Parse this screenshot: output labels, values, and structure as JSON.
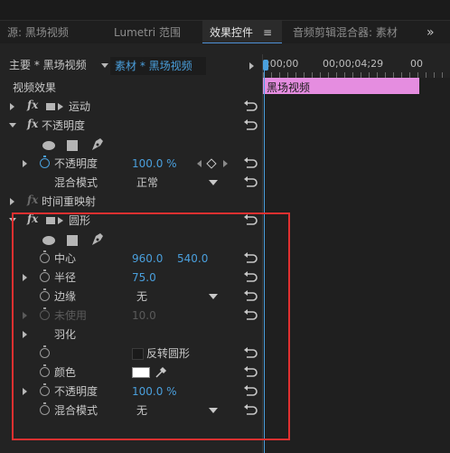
{
  "tabs": [
    {
      "label": "源: 黑场视频"
    },
    {
      "label": "Lumetri 范围"
    },
    {
      "label": "效果控件"
    },
    {
      "label": "音频剪辑混合器: 素材"
    }
  ],
  "tab_menu_icon": "≡",
  "tab_overflow_icon": "»",
  "header": {
    "master": "主要 * 黑场视频",
    "clip": "素材 * 黑场视频"
  },
  "timeline": {
    "start_tc": ";00;00",
    "mid_tc": "00;00;04;29",
    "end_tc": "00",
    "clip_label": "黑场视频"
  },
  "section_label": "视频效果",
  "effects": {
    "motion": "运动",
    "opacity": {
      "name": "不透明度",
      "prop_label": "不透明度",
      "value": "100.0 %",
      "blend_label": "混合模式",
      "blend_value": "正常"
    },
    "time_remap": "时间重映射",
    "circle": {
      "name": "圆形",
      "center_label": "中心",
      "center_x": "960.0",
      "center_y": "540.0",
      "radius_label": "半径",
      "radius_value": "75.0",
      "edge_label": "边缘",
      "edge_value": "无",
      "unused_label": "未使用",
      "unused_value": "10.0",
      "feather_label": "羽化",
      "invert_label": "反转圆形",
      "color_label": "颜色",
      "color_value": "#ffffff",
      "opacity_label": "不透明度",
      "opacity_value": "100.0 %",
      "blend_label": "混合模式",
      "blend_value": "无"
    }
  },
  "colors": {
    "accent": "#4a9fdc",
    "clip": "#e58de0",
    "highlight_box": "#e03030"
  }
}
